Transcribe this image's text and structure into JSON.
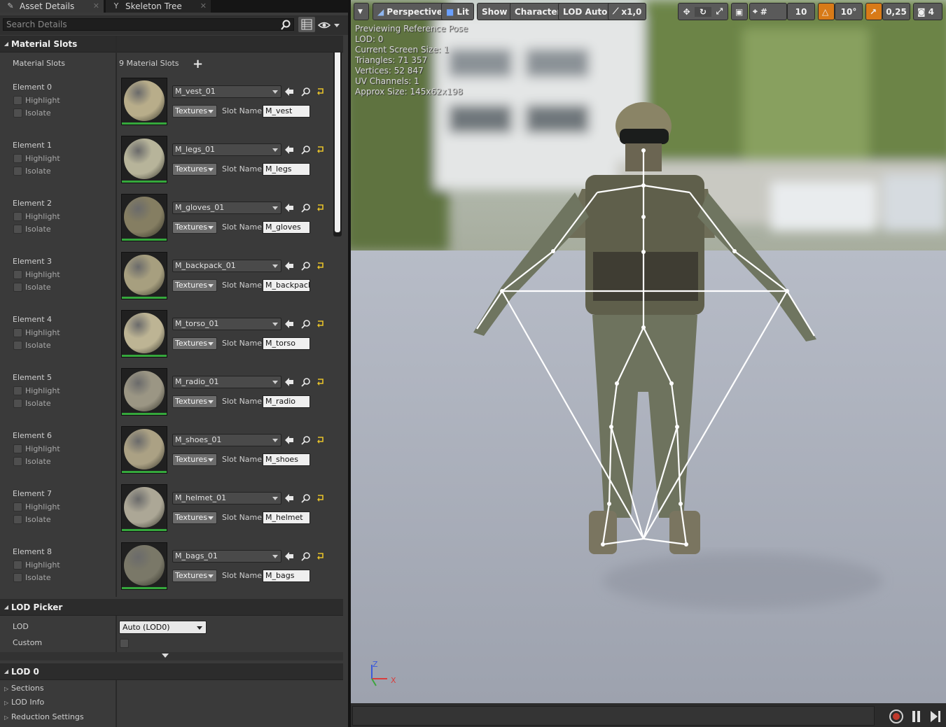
{
  "tabs": [
    {
      "label": "Asset Details",
      "icon": "asset-details-icon"
    },
    {
      "label": "Skeleton Tree",
      "icon": "skeleton-tree-icon"
    }
  ],
  "search": {
    "placeholder": "Search Details"
  },
  "material_slots": {
    "header": "Material Slots",
    "row_label": "Material Slots",
    "count_text": "9 Material Slots",
    "highlight_label": "Highlight",
    "isolate_label": "Isolate",
    "textures_label": "Textures",
    "slot_name_label": "Slot Name",
    "elements": [
      {
        "label": "Element 0",
        "material": "M_vest_01",
        "slot_name": "M_vest",
        "color": "#b8ad8a"
      },
      {
        "label": "Element 1",
        "material": "M_legs_01",
        "slot_name": "M_legs",
        "color": "#b7b49a"
      },
      {
        "label": "Element 2",
        "material": "M_gloves_01",
        "slot_name": "M_gloves",
        "color": "#857e62"
      },
      {
        "label": "Element 3",
        "material": "M_backpack_01",
        "slot_name": "M_backpacl",
        "color": "#a79f7f"
      },
      {
        "label": "Element 4",
        "material": "M_torso_01",
        "slot_name": "M_torso",
        "color": "#bdb494"
      },
      {
        "label": "Element 5",
        "material": "M_radio_01",
        "slot_name": "M_radio",
        "color": "#9b9684"
      },
      {
        "label": "Element 6",
        "material": "M_shoes_01",
        "slot_name": "M_shoes",
        "color": "#aba184"
      },
      {
        "label": "Element 7",
        "material": "M_helmet_01",
        "slot_name": "M_helmet",
        "color": "#aca796"
      },
      {
        "label": "Element 8",
        "material": "M_bags_01",
        "slot_name": "M_bags",
        "color": "#7a7868"
      }
    ]
  },
  "lod_picker": {
    "header": "LOD Picker",
    "lod_label": "LOD",
    "lod_value": "Auto (LOD0)",
    "custom_label": "Custom"
  },
  "lod0": {
    "header": "LOD 0",
    "items": [
      "Sections",
      "LOD Info",
      "Reduction Settings"
    ]
  },
  "viewport": {
    "toolbar": {
      "perspective": "Perspective",
      "lit": "Lit",
      "show": "Show",
      "character": "Character",
      "lod": "LOD Auto",
      "speed": "x1,0",
      "grid_snap": "10",
      "rot_snap": "10°",
      "scale_snap": "0,25",
      "cam_speed": "4"
    },
    "stats": [
      "Previewing Reference Pose",
      "LOD: 0",
      "Current Screen Size: 1",
      "Triangles: 71 357",
      "Vertices: 52 847",
      "UV Channels: 1",
      "Approx Size: 145x62x198"
    ],
    "axis_x": "X",
    "axis_z": "Z",
    "colors": {
      "accent_orange": "#d87a17",
      "green_bar": "#35a83c"
    }
  }
}
